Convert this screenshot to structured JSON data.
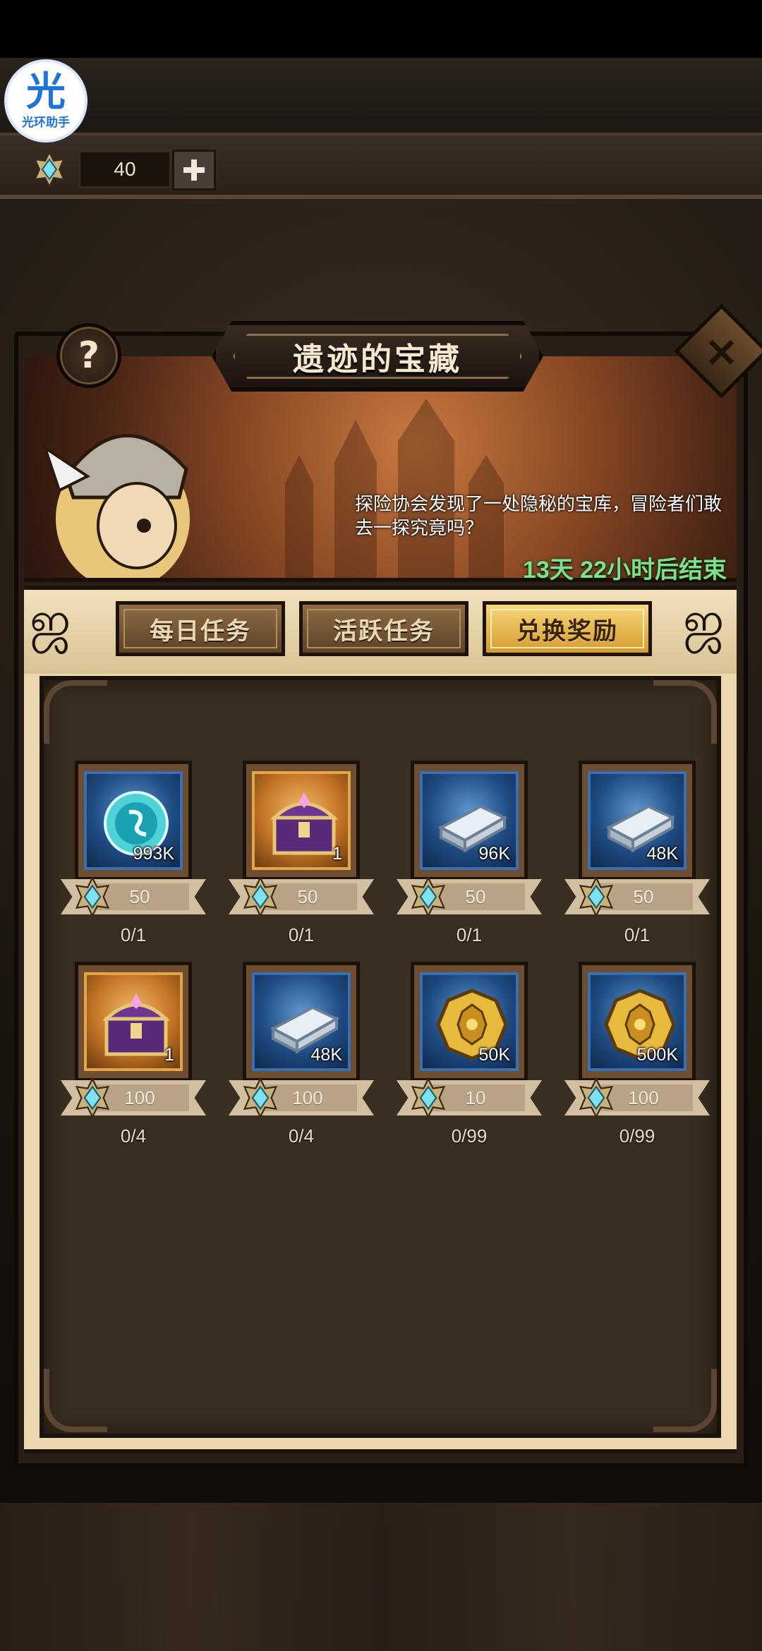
{
  "assistant_badge": {
    "big": "光",
    "small": "光环助手"
  },
  "currency": {
    "count": "40",
    "icon": "gem-icon"
  },
  "event": {
    "title": "遗迹的宝藏",
    "description": "探险协会发现了一处隐秘的宝库，冒险者们敢去一探究竟吗？",
    "timer": "13天 22小时后结束",
    "help_label": "?",
    "close_label": "×"
  },
  "tabs": [
    {
      "label": "每日任务",
      "active": false
    },
    {
      "label": "活跃任务",
      "active": false
    },
    {
      "label": "兑换奖励",
      "active": true
    }
  ],
  "rewards": [
    {
      "icon": "crystal-orb-icon",
      "bg": "blue",
      "qty": "993K",
      "price": "50",
      "progress": "0/1"
    },
    {
      "icon": "treasure-chest-icon",
      "bg": "gold",
      "qty": "1",
      "price": "50",
      "progress": "0/1"
    },
    {
      "icon": "silver-ingot-icon",
      "bg": "blue",
      "qty": "96K",
      "price": "50",
      "progress": "0/1"
    },
    {
      "icon": "silver-ingot-icon",
      "bg": "blue",
      "qty": "48K",
      "price": "50",
      "progress": "0/1"
    },
    {
      "icon": "treasure-chest-icon",
      "bg": "gold",
      "qty": "1",
      "price": "100",
      "progress": "0/4"
    },
    {
      "icon": "silver-ingot-icon",
      "bg": "blue",
      "qty": "48K",
      "price": "100",
      "progress": "0/4"
    },
    {
      "icon": "gold-coin-icon",
      "bg": "blue",
      "qty": "50K",
      "price": "10",
      "progress": "0/99"
    },
    {
      "icon": "gold-coin-icon",
      "bg": "blue",
      "qty": "500K",
      "price": "100",
      "progress": "0/99"
    }
  ],
  "colors": {
    "timer": "#7ee08a",
    "active_tab": "#f7d67a",
    "panel": "#3a2e22"
  }
}
